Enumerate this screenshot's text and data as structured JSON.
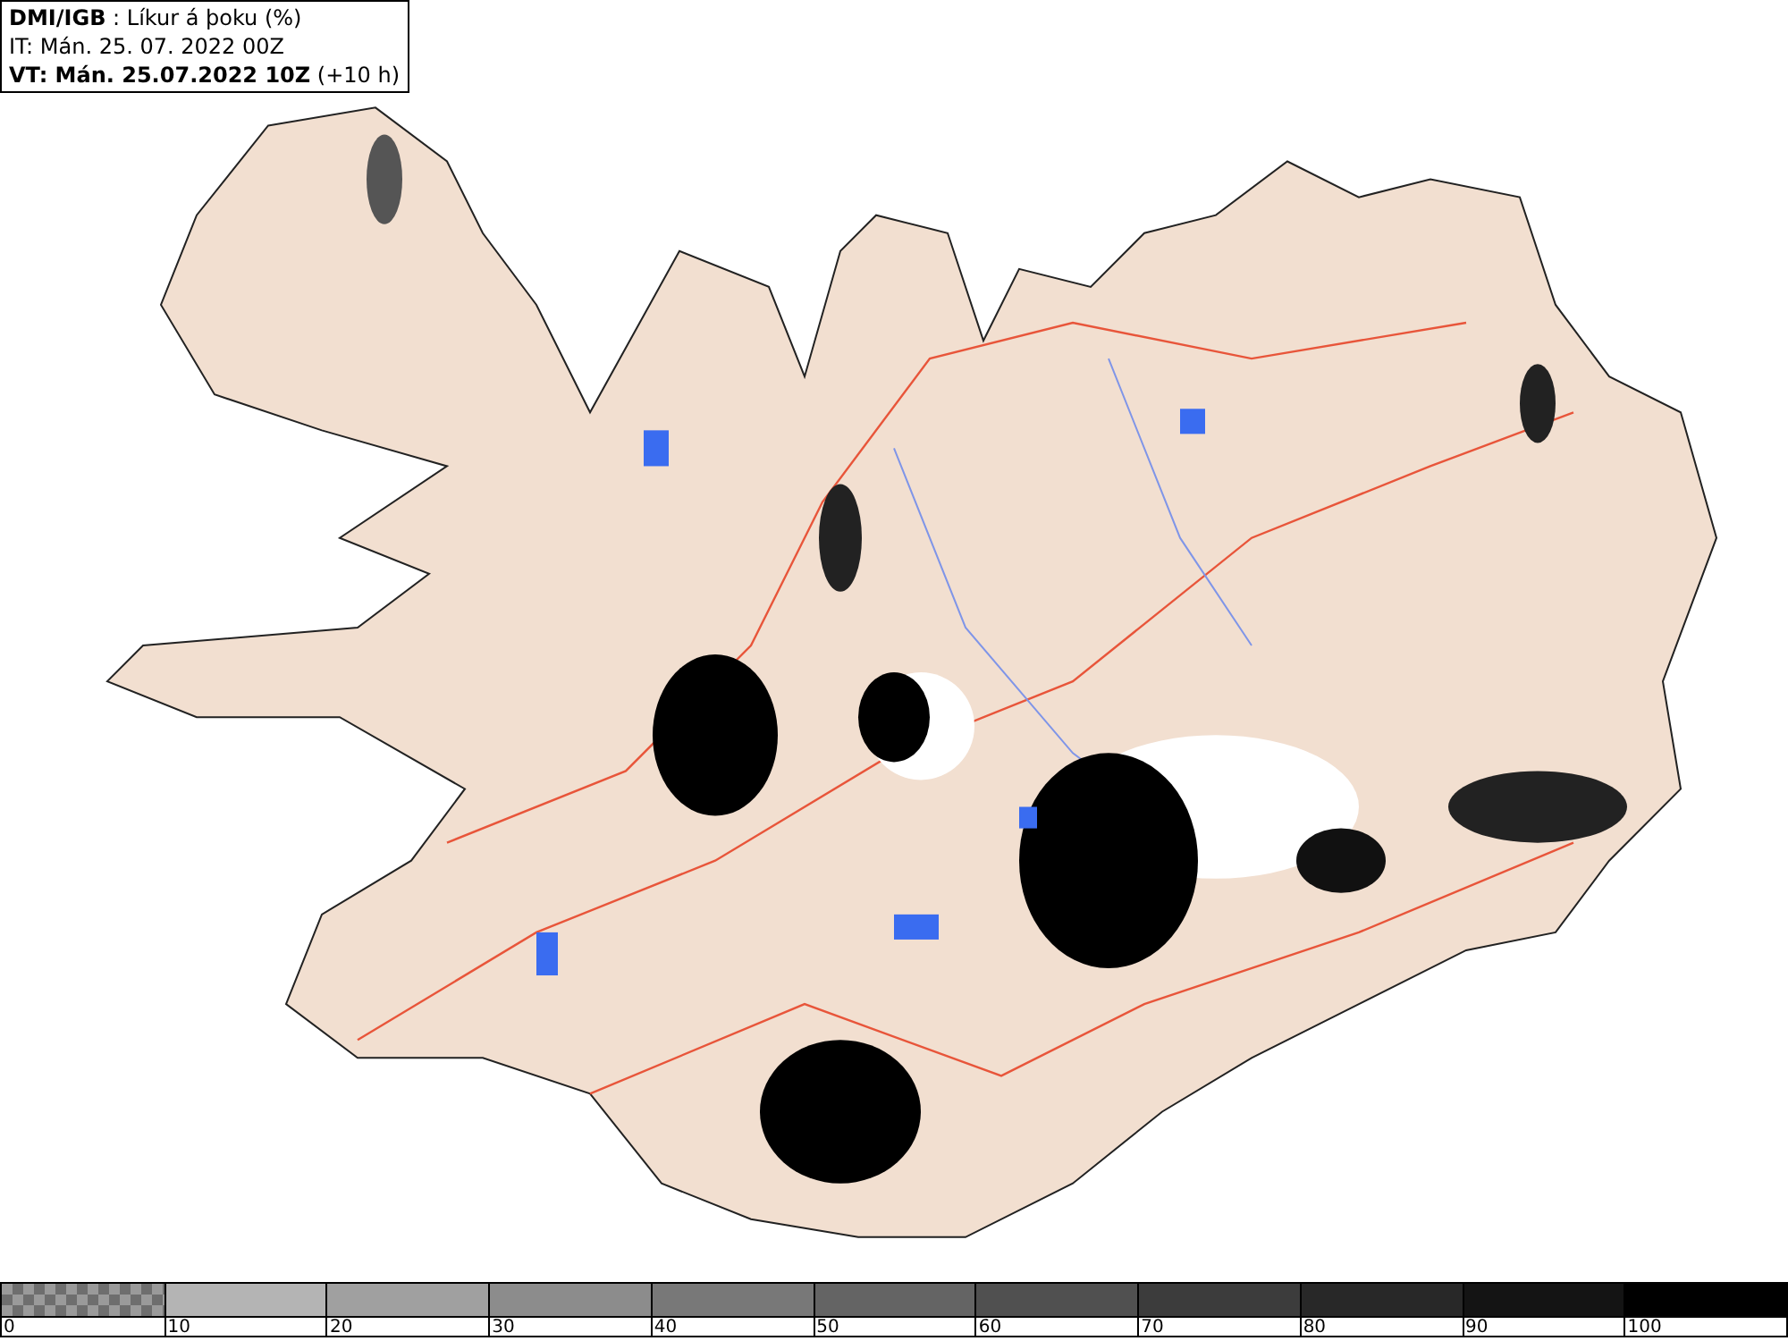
{
  "info_box": {
    "lines": [
      "**DMI/IGB** : Líkur á þoku (%)",
      "IT: Mán. 25. 07. 2022 00Z",
      "**VT: Mán. 25.07.2022 10Z** (+10 h)"
    ]
  },
  "legend": {
    "segments": [
      {
        "kind": "checker",
        "label": "0"
      },
      {
        "kind": "solid",
        "color": "#b4b4b4",
        "label": "10"
      },
      {
        "kind": "solid",
        "color": "#a0a0a0",
        "label": "20"
      },
      {
        "kind": "solid",
        "color": "#8c8c8c",
        "label": "30"
      },
      {
        "kind": "solid",
        "color": "#787878",
        "label": "40"
      },
      {
        "kind": "solid",
        "color": "#646464",
        "label": "50"
      },
      {
        "kind": "solid",
        "color": "#505050",
        "label": "60"
      },
      {
        "kind": "solid",
        "color": "#3c3c3c",
        "label": "70"
      },
      {
        "kind": "solid",
        "color": "#282828",
        "label": "80"
      },
      {
        "kind": "solid",
        "color": "#141414",
        "label": "90"
      },
      {
        "kind": "solid",
        "color": "#000000",
        "label": "100"
      }
    ]
  }
}
